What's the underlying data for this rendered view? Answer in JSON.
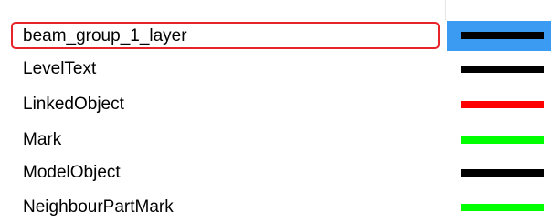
{
  "layers": [
    {
      "name": "beam_group_1_layer",
      "color": "#000000",
      "selected": true
    },
    {
      "name": "LevelText",
      "color": "#000000",
      "selected": false
    },
    {
      "name": "LinkedObject",
      "color": "#ff0000",
      "selected": false
    },
    {
      "name": "Mark",
      "color": "#00ff00",
      "selected": false
    },
    {
      "name": "ModelObject",
      "color": "#000000",
      "selected": false
    },
    {
      "name": "NeighbourPartMark",
      "color": "#00ff00",
      "selected": false
    }
  ],
  "selection_color": "#e8242b",
  "highlight_color": "#3b9bf3"
}
